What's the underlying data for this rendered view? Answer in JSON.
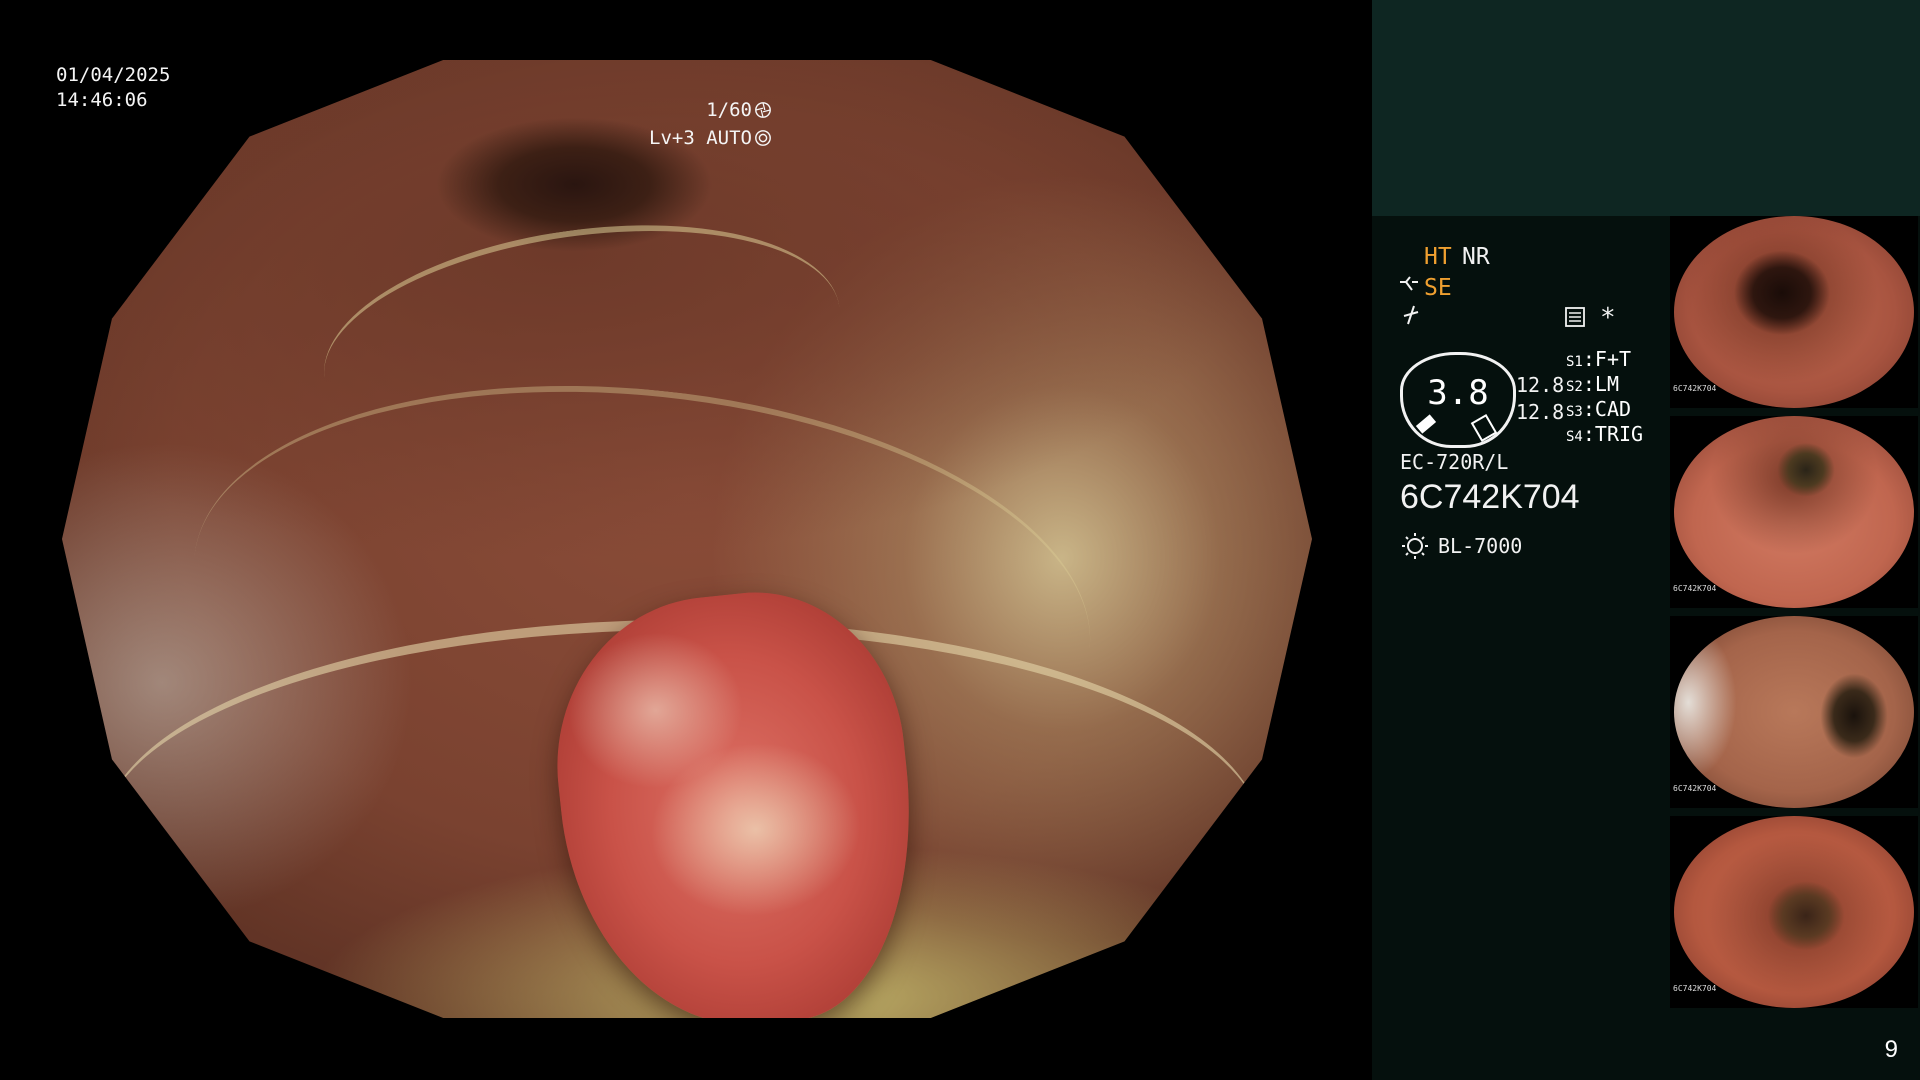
{
  "overlay": {
    "date": "01/04/2025",
    "time": "14:46:06",
    "shutter": "1/60",
    "level": "Lv+3",
    "exposure_mode": "AUTO"
  },
  "panel": {
    "ht": "HT",
    "nr": "NR",
    "se": "SE",
    "star": "*",
    "gauge_value": "3.8",
    "value_1": "12.8",
    "value_2": "12.8",
    "switches": [
      {
        "key": "S1",
        "value": "F+T"
      },
      {
        "key": "S2",
        "value": "LM"
      },
      {
        "key": "S3",
        "value": "CAD"
      },
      {
        "key": "S4",
        "value": "TRIG"
      }
    ],
    "scope_model": "EC-720R/L",
    "serial": "6C742K704",
    "light_source": "BL-7000",
    "thumb_serial": "6C742K704"
  },
  "page_number": "9",
  "colors": {
    "panel_background": "#05100d",
    "panel_top": "#0e2622",
    "orange_highlight": "#f0a030"
  },
  "icons": [
    "shutter-icon",
    "iris-icon",
    "structure-enhancement-icon",
    "slash-icon",
    "mode-icon",
    "light-source-icon"
  ]
}
